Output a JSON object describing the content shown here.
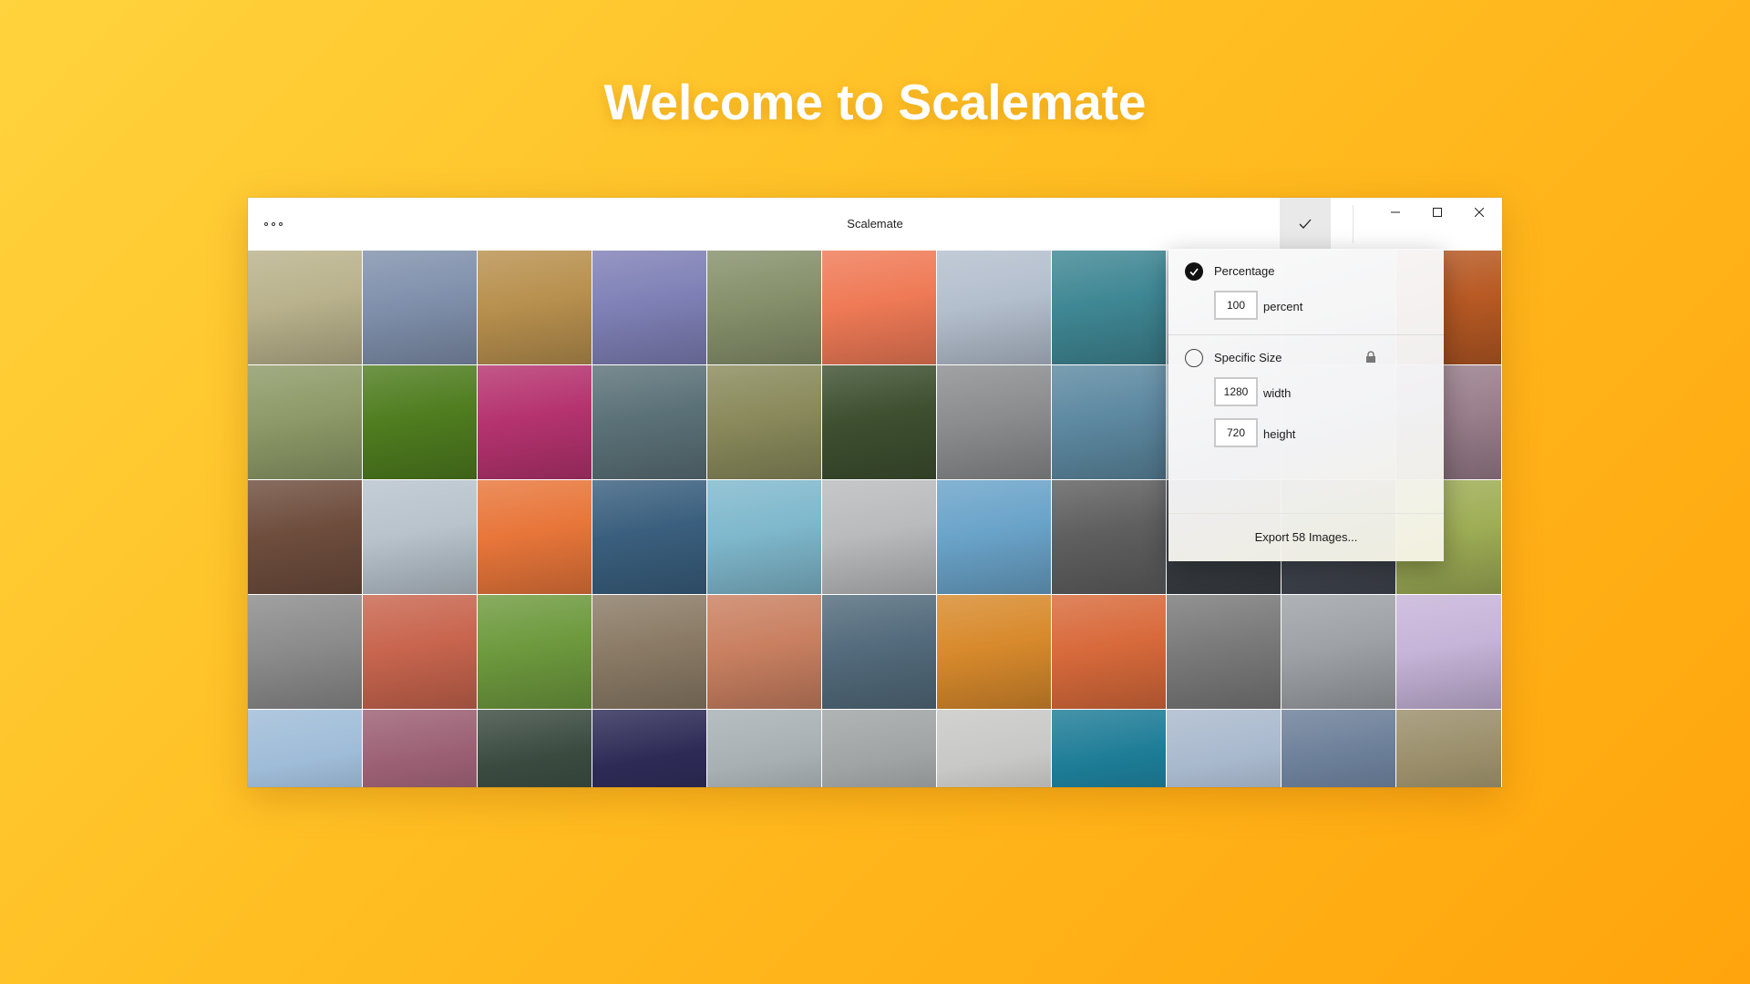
{
  "hero": {
    "title": "Welcome to Scalemate"
  },
  "window": {
    "title": "Scalemate",
    "more_icon": "more-icon",
    "apply_icon": "checkmark-icon",
    "controls": [
      "minimize-icon",
      "maximize-icon",
      "close-icon"
    ]
  },
  "colors": {
    "background_start": "#ffd33d",
    "background_end": "#ffa40c",
    "accent_radio": "#111111"
  },
  "popup": {
    "percentage": {
      "label": "Percentage",
      "selected": true,
      "value": "100",
      "unit": "percent"
    },
    "specific": {
      "label": "Specific Size",
      "selected": false,
      "lock_icon": "lock-icon",
      "width_value": "1280",
      "width_unit": "width",
      "height_value": "720",
      "height_unit": "height"
    },
    "export_label": "Export  58  Images..."
  },
  "gallery": {
    "rows": [
      [
        "#b9b28c",
        "#8090ac",
        "#b8904e",
        "#7f80b6",
        "#86906b",
        "#ef7a56",
        "#b4bfce",
        "#3f8794",
        "#d4d8de",
        "#cfd3d7",
        "#b85a24"
      ],
      [
        "#8e9a68",
        "#4f7d1f",
        "#b5336f",
        "#5b7178",
        "#8a8a5c",
        "#3e5030",
        "#8c8d8f",
        "#5d89a1",
        "#d8dde0",
        "#d2d7da",
        "#9a7f8c"
      ],
      [
        "#6e4d3d",
        "#b8c3cc",
        "#e8763a",
        "#3a5f7e",
        "#7fb8cc",
        "#b9bbbc",
        "#6aa3c9",
        "#5f5f5f",
        "#3b4046",
        "#434852",
        "#9fae56"
      ],
      [
        "#8c8c8c",
        "#c8654e",
        "#6e9a3e",
        "#8b7b66",
        "#c98061",
        "#536b7c",
        "#d88a2c",
        "#d86a3b",
        "#7a7a7a",
        "#9ea2a6",
        "#c7b4d9"
      ],
      [
        "#9fbcd8",
        "#9b5f73",
        "#3a4a3f",
        "#2d2a56",
        "#a8b0b4",
        "#a0a4a5",
        "#c8c8c6",
        "#1d7c96",
        "#a9b9cd",
        "#6b7e98",
        "#9a8e6a"
      ]
    ]
  }
}
